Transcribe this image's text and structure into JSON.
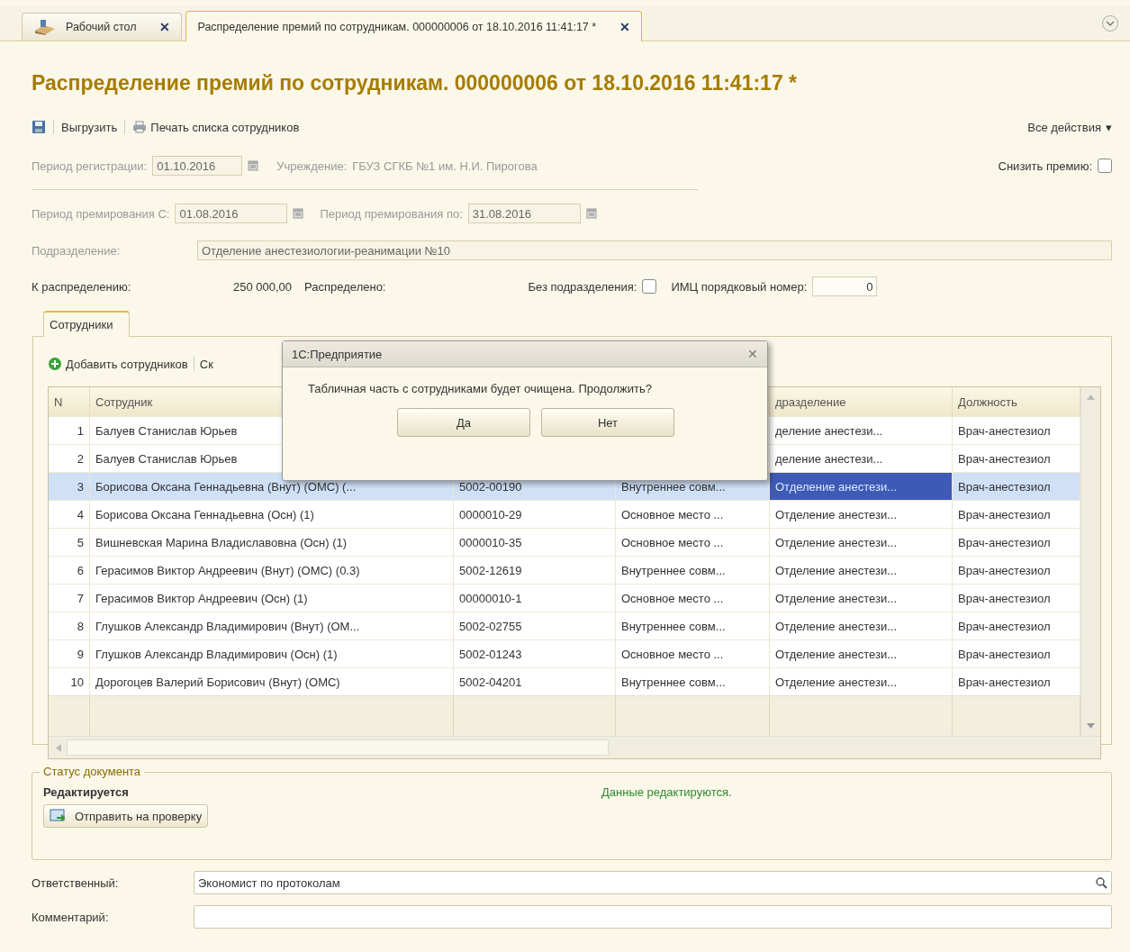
{
  "tabs": [
    {
      "label": "Рабочий стол",
      "close": "✕",
      "selected": false
    },
    {
      "label": "Распределение премий по сотрудникам. 000000006 от 18.10.2016 11:41:17 *",
      "close": "✕",
      "selected": true
    }
  ],
  "title": "Распределение премий по сотрудникам. 000000006 от 18.10.2016 11:41:17 *",
  "toolbar": {
    "buttons": [
      {
        "kind": "save"
      },
      {
        "kind": "text",
        "label": "Выгрузить"
      },
      {
        "kind": "print",
        "label": "Печать списка сотрудников"
      }
    ],
    "all_actions": {
      "label": "Все действия",
      "caret": "▾"
    }
  },
  "fields": {
    "registration_period": {
      "label": "Период регистрации:",
      "value": "01.10.2016",
      "disabled": true
    },
    "institution": {
      "label": "Учреждение:",
      "value": "ГБУЗ СГКБ №1 им. Н.И. Пирогова",
      "disabled": true
    },
    "reduce_bonus": {
      "label": "Снизить премию:",
      "checked": false
    },
    "bonus_from": {
      "label": "Период премирования С:",
      "value": "01.08.2016",
      "disabled": true
    },
    "bonus_to": {
      "label": "Период премирования по:",
      "value": "31.08.2016",
      "disabled": true
    },
    "department": {
      "label": "Подразделение:",
      "value": "Отделение анестезиологии-реанимации №10",
      "disabled": true
    },
    "to_distribute": {
      "label": "К распределению:",
      "value": "250 000,00"
    },
    "distributed": {
      "label": "Распределено:"
    },
    "no_department": {
      "label": "Без подразделения:",
      "checked": false
    },
    "imc_number": {
      "label": "ИМЦ порядковый номер:",
      "value": "0"
    }
  },
  "section_tabs": [
    {
      "label": "Сотрудники",
      "selected": true
    }
  ],
  "table_toolbar": [
    {
      "kind": "add",
      "label": "Добавить сотрудников"
    },
    {
      "kind": "text",
      "label": "Ск"
    }
  ],
  "table": {
    "columns": [
      {
        "label": "N"
      },
      {
        "label": "Сотрудник"
      },
      null,
      null,
      {
        "label": "дразделение"
      },
      {
        "label": "Должность"
      }
    ],
    "rows": [
      {
        "n": "1",
        "employee": "Балуев Станислав Юрьев",
        "department": "деление анестези...",
        "position": "Врач-анестезиол",
        "selected": false
      },
      {
        "n": "2",
        "employee": "Балуев Станислав Юрьев",
        "department": "деление анестези...",
        "position": "Врач-анестезиол",
        "selected": false
      },
      {
        "n": "3",
        "employee": "Борисова Оксана Геннадьевна (Внут) (ОМС) (...",
        "code": "5002-00190",
        "kind": "Внутреннее совм...",
        "department": "Отделение анестези...",
        "position": "Врач-анестезиол",
        "selected": true
      },
      {
        "n": "4",
        "employee": "Борисова Оксана Геннадьевна (Осн) (1)",
        "code": "0000010-29",
        "kind": "Основное место ...",
        "department": "Отделение анестези...",
        "position": "Врач-анестезиол",
        "selected": false
      },
      {
        "n": "5",
        "employee": "Вишневская Марина Владиславовна (Осн) (1)",
        "code": "0000010-35",
        "kind": "Основное место ...",
        "department": "Отделение анестези...",
        "position": "Врач-анестезиол",
        "selected": false
      },
      {
        "n": "6",
        "employee": "Герасимов Виктор Андреевич (Внут) (ОМС) (0.3)",
        "code": "5002-12619",
        "kind": "Внутреннее совм...",
        "department": "Отделение анестези...",
        "position": "Врач-анестезиол",
        "selected": false
      },
      {
        "n": "7",
        "employee": "Герасимов Виктор Андреевич (Осн) (1)",
        "code": "00000010-1",
        "kind": "Основное место ...",
        "department": "Отделение анестези...",
        "position": "Врач-анестезиол",
        "selected": false
      },
      {
        "n": "8",
        "employee": "Глушков Александр Владимирович (Внут) (ОМ...",
        "code": "5002-02755",
        "kind": "Внутреннее совм...",
        "department": "Отделение анестези...",
        "position": "Врач-анестезиол",
        "selected": false
      },
      {
        "n": "9",
        "employee": "Глушков Александр Владимирович (Осн) (1)",
        "code": "5002-01243",
        "kind": "Основное место ...",
        "department": "Отделение анестези...",
        "position": "Врач-анестезиол",
        "selected": false
      },
      {
        "n": "10",
        "employee": "Дорогоцев Валерий Борисович (Внут) (ОМС)",
        "code": "5002-04201",
        "kind": "Внутреннее совм...",
        "department": "Отделение анестези...",
        "position": "Врач-анестезиол",
        "selected": false
      }
    ]
  },
  "status": {
    "legend": "Статус документа",
    "state": "Редактируется",
    "message": "Данные редактируются.",
    "button": "Отправить на проверку"
  },
  "responsible": {
    "label": "Ответственный:",
    "value": "Экономист по протоколам"
  },
  "comment": {
    "label": "Комментарий:"
  },
  "dialog": {
    "title": "1С:Предприятие",
    "close": "✕",
    "message": "Табличная часть с сотрудниками будет очищена. Продолжить?",
    "buttons": [
      {
        "label": "Да"
      },
      {
        "label": "Нет"
      }
    ]
  }
}
